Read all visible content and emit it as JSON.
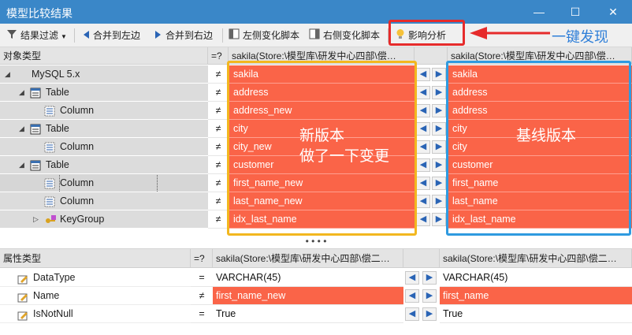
{
  "window": {
    "title": "模型比较结果",
    "minimize": "—",
    "maximize": "☐",
    "close": "✕"
  },
  "toolbar": {
    "filter": "结果过滤",
    "merge_left": "合并到左边",
    "merge_right": "合并到右边",
    "left_script": "左侧变化脚本",
    "right_script": "右侧变化脚本",
    "impact": "影响分析"
  },
  "annotation": {
    "text": "一键发现",
    "new_version": [
      "新版本",
      "做了一下变更"
    ],
    "baseline": "基线版本"
  },
  "top_grid": {
    "headers": {
      "type": "对象类型",
      "eq": "=?",
      "left": "sakila(Store:\\模型库\\研发中心四部\\偿…",
      "right": "sakila(Store:\\模型库\\研发中心四部\\偿…"
    },
    "rows": [
      {
        "type": "MySQL 5.x",
        "eq": "≠",
        "left": "sakila",
        "right": "sakila"
      },
      {
        "type": "Table",
        "eq": "≠",
        "left": "address",
        "right": "address"
      },
      {
        "type": "Column",
        "eq": "≠",
        "left": "address_new",
        "right": "address"
      },
      {
        "type": "Table",
        "eq": "≠",
        "left": "city",
        "right": "city"
      },
      {
        "type": "Column",
        "eq": "≠",
        "left": "city_new",
        "right": "city"
      },
      {
        "type": "Table",
        "eq": "≠",
        "left": "customer",
        "right": "customer"
      },
      {
        "type": "Column",
        "eq": "≠",
        "left": "first_name_new",
        "right": "first_name"
      },
      {
        "type": "Column",
        "eq": "≠",
        "left": "last_name_new",
        "right": "last_name"
      },
      {
        "type": "KeyGroup",
        "eq": "≠",
        "left": "idx_last_name",
        "right": "idx_last_name"
      }
    ]
  },
  "splitter": "• • • •",
  "bottom_grid": {
    "headers": {
      "type": "属性类型",
      "eq": "=?",
      "left": "sakila(Store:\\模型库\\研发中心四部\\偿二…",
      "right": "sakila(Store:\\模型库\\研发中心四部\\偿二…"
    },
    "rows": [
      {
        "type": "DataType",
        "eq": "=",
        "left": "VARCHAR(45)",
        "right": "VARCHAR(45)"
      },
      {
        "type": "Name",
        "eq": "≠",
        "left": "first_name_new",
        "right": "first_name"
      },
      {
        "type": "IsNotNull",
        "eq": "=",
        "left": "True",
        "right": "True"
      }
    ]
  },
  "colors": {
    "titlebar": "#3a87c8",
    "diff": "#fa6448",
    "annot_red": "#e62b2b",
    "annot_yellow": "#f2b71f",
    "annot_blue": "#2f9ae0"
  }
}
